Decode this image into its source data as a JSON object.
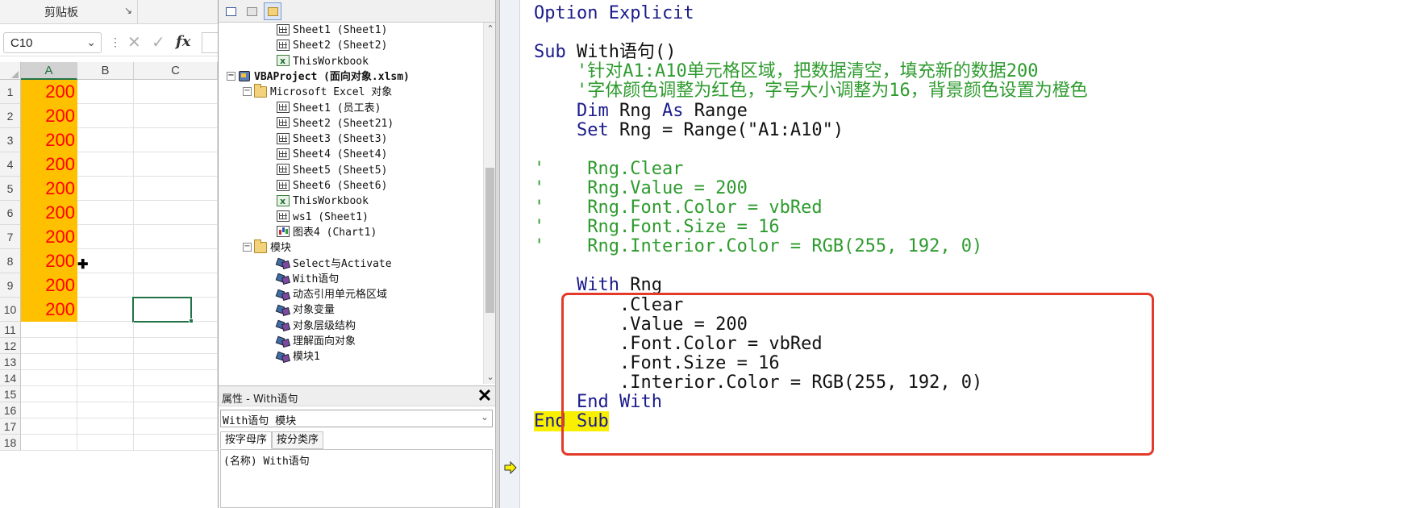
{
  "excel": {
    "ribbon": {
      "group_label": "剪贴板",
      "launcher": "↘"
    },
    "name_box": "C10",
    "formula_bar": {
      "fx": "fx"
    },
    "columns": [
      "A",
      "B",
      "C"
    ],
    "rows": [
      "1",
      "2",
      "3",
      "4",
      "5",
      "6",
      "7",
      "8",
      "9",
      "10",
      "11",
      "12",
      "13",
      "14",
      "15",
      "16",
      "17",
      "18"
    ],
    "column_a_values": [
      "200",
      "200",
      "200",
      "200",
      "200",
      "200",
      "200",
      "200",
      "200",
      "200"
    ],
    "colors": {
      "fill": "#FFC000",
      "font": "#FF0000"
    }
  },
  "project": {
    "tree": [
      {
        "label": "Sheet1 (Sheet1)",
        "icon": "sheet-icon"
      },
      {
        "label": "Sheet2 (Sheet2)",
        "icon": "sheet-icon"
      },
      {
        "label": "ThisWorkbook",
        "icon": "workbook-icon"
      },
      {
        "label": "VBAProject (面向对象.xlsm)",
        "icon": "vba-project-icon"
      },
      {
        "label": "Microsoft Excel 对象",
        "icon": "folder-icon"
      },
      {
        "label": "Sheet1 (员工表)",
        "icon": "sheet-icon"
      },
      {
        "label": "Sheet2 (Sheet21)",
        "icon": "sheet-icon"
      },
      {
        "label": "Sheet3 (Sheet3)",
        "icon": "sheet-icon"
      },
      {
        "label": "Sheet4 (Sheet4)",
        "icon": "sheet-icon"
      },
      {
        "label": "Sheet5 (Sheet5)",
        "icon": "sheet-icon"
      },
      {
        "label": "Sheet6 (Sheet6)",
        "icon": "sheet-icon"
      },
      {
        "label": "ThisWorkbook",
        "icon": "workbook-icon"
      },
      {
        "label": "ws1 (Sheet1)",
        "icon": "sheet-icon"
      },
      {
        "label": "图表4 (Chart1)",
        "icon": "chart-icon"
      },
      {
        "label": "模块",
        "icon": "folder-icon"
      },
      {
        "label": "Select与Activate",
        "icon": "module-icon"
      },
      {
        "label": "With语句",
        "icon": "module-icon"
      },
      {
        "label": "动态引用单元格区域",
        "icon": "module-icon"
      },
      {
        "label": "对象变量",
        "icon": "module-icon"
      },
      {
        "label": "对象层级结构",
        "icon": "module-icon"
      },
      {
        "label": "理解面向对象",
        "icon": "module-icon"
      },
      {
        "label": "模块1",
        "icon": "module-icon"
      }
    ],
    "toggles": {
      "collapse": "−"
    }
  },
  "properties": {
    "title": "属性 - With语句",
    "close": "✕",
    "object": "With语句 模块",
    "tabs": [
      "按字母序",
      "按分类序"
    ],
    "row": "(名称) With语句"
  },
  "code": {
    "lines": [
      {
        "segments": [
          {
            "text": "Option Explicit",
            "style": "kw"
          }
        ]
      },
      {
        "segments": []
      },
      {
        "segments": [
          {
            "text": "Sub ",
            "style": "kw"
          },
          {
            "text": "With语句()",
            "style": "plain"
          }
        ]
      },
      {
        "segments": [
          {
            "text": "    '针对A1:A10单元格区域，把数据清空，填充新的数据200",
            "style": "cmt"
          }
        ]
      },
      {
        "segments": [
          {
            "text": "    '字体颜色调整为红色，字号大小调整为16，背景颜色设置为橙色",
            "style": "cmt"
          }
        ]
      },
      {
        "segments": [
          {
            "text": "    ",
            "style": "plain"
          },
          {
            "text": "Dim ",
            "style": "kw"
          },
          {
            "text": "Rng ",
            "style": "plain"
          },
          {
            "text": "As ",
            "style": "kw"
          },
          {
            "text": "Range",
            "style": "plain"
          }
        ]
      },
      {
        "segments": [
          {
            "text": "    ",
            "style": "plain"
          },
          {
            "text": "Set ",
            "style": "kw"
          },
          {
            "text": "Rng = Range(\"A1:A10\")",
            "style": "plain"
          }
        ]
      },
      {
        "segments": []
      },
      {
        "segments": [
          {
            "text": "'    Rng.Clear",
            "style": "cmt"
          }
        ]
      },
      {
        "segments": [
          {
            "text": "'    Rng.Value = 200",
            "style": "cmt"
          }
        ]
      },
      {
        "segments": [
          {
            "text": "'    Rng.Font.Color = vbRed",
            "style": "cmt"
          }
        ]
      },
      {
        "segments": [
          {
            "text": "'    Rng.Font.Size = 16",
            "style": "cmt"
          }
        ]
      },
      {
        "segments": [
          {
            "text": "'    Rng.Interior.Color = RGB(255, 192, 0)",
            "style": "cmt"
          }
        ]
      },
      {
        "segments": []
      },
      {
        "segments": [
          {
            "text": "    ",
            "style": "plain"
          },
          {
            "text": "With ",
            "style": "kw"
          },
          {
            "text": "Rng",
            "style": "plain"
          }
        ]
      },
      {
        "segments": [
          {
            "text": "        .Clear",
            "style": "plain"
          }
        ]
      },
      {
        "segments": [
          {
            "text": "        .Value = 200",
            "style": "plain"
          }
        ]
      },
      {
        "segments": [
          {
            "text": "        .Font.Color = vbRed",
            "style": "plain"
          }
        ]
      },
      {
        "segments": [
          {
            "text": "        .Font.Size = 16",
            "style": "plain"
          }
        ]
      },
      {
        "segments": [
          {
            "text": "        .Interior.Color = RGB(255, 192, 0)",
            "style": "plain"
          }
        ]
      },
      {
        "segments": [
          {
            "text": "    ",
            "style": "plain"
          },
          {
            "text": "End With",
            "style": "kw"
          }
        ]
      },
      {
        "segments": [
          {
            "text": "End Sub",
            "style": "kw-hl"
          }
        ]
      }
    ],
    "colors": {
      "keyword": "#1B1B8C",
      "comment": "#2E9B2E",
      "highlight": "#F8F000",
      "box": "#E23B2A"
    }
  }
}
